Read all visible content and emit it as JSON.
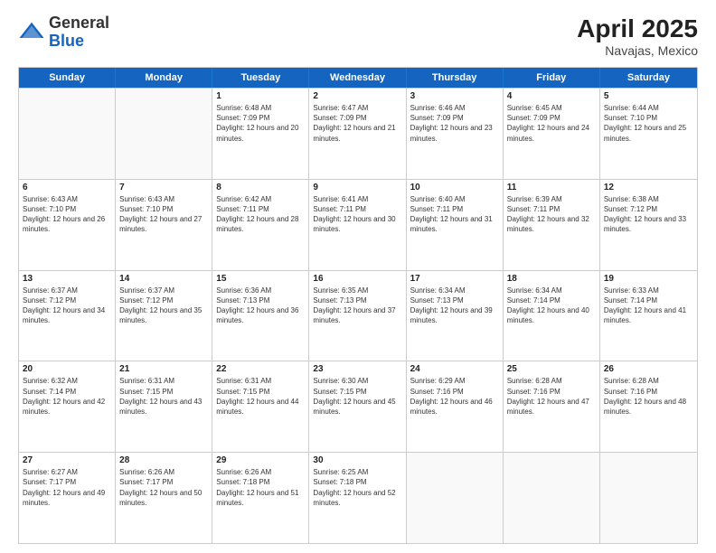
{
  "header": {
    "logo_general": "General",
    "logo_blue": "Blue",
    "title": "April 2025",
    "subtitle": "Navajas, Mexico"
  },
  "days_of_week": [
    "Sunday",
    "Monday",
    "Tuesday",
    "Wednesday",
    "Thursday",
    "Friday",
    "Saturday"
  ],
  "weeks": [
    [
      {
        "day": "",
        "info": ""
      },
      {
        "day": "",
        "info": ""
      },
      {
        "day": "1",
        "info": "Sunrise: 6:48 AM\nSunset: 7:09 PM\nDaylight: 12 hours and 20 minutes."
      },
      {
        "day": "2",
        "info": "Sunrise: 6:47 AM\nSunset: 7:09 PM\nDaylight: 12 hours and 21 minutes."
      },
      {
        "day": "3",
        "info": "Sunrise: 6:46 AM\nSunset: 7:09 PM\nDaylight: 12 hours and 23 minutes."
      },
      {
        "day": "4",
        "info": "Sunrise: 6:45 AM\nSunset: 7:09 PM\nDaylight: 12 hours and 24 minutes."
      },
      {
        "day": "5",
        "info": "Sunrise: 6:44 AM\nSunset: 7:10 PM\nDaylight: 12 hours and 25 minutes."
      }
    ],
    [
      {
        "day": "6",
        "info": "Sunrise: 6:43 AM\nSunset: 7:10 PM\nDaylight: 12 hours and 26 minutes."
      },
      {
        "day": "7",
        "info": "Sunrise: 6:43 AM\nSunset: 7:10 PM\nDaylight: 12 hours and 27 minutes."
      },
      {
        "day": "8",
        "info": "Sunrise: 6:42 AM\nSunset: 7:11 PM\nDaylight: 12 hours and 28 minutes."
      },
      {
        "day": "9",
        "info": "Sunrise: 6:41 AM\nSunset: 7:11 PM\nDaylight: 12 hours and 30 minutes."
      },
      {
        "day": "10",
        "info": "Sunrise: 6:40 AM\nSunset: 7:11 PM\nDaylight: 12 hours and 31 minutes."
      },
      {
        "day": "11",
        "info": "Sunrise: 6:39 AM\nSunset: 7:11 PM\nDaylight: 12 hours and 32 minutes."
      },
      {
        "day": "12",
        "info": "Sunrise: 6:38 AM\nSunset: 7:12 PM\nDaylight: 12 hours and 33 minutes."
      }
    ],
    [
      {
        "day": "13",
        "info": "Sunrise: 6:37 AM\nSunset: 7:12 PM\nDaylight: 12 hours and 34 minutes."
      },
      {
        "day": "14",
        "info": "Sunrise: 6:37 AM\nSunset: 7:12 PM\nDaylight: 12 hours and 35 minutes."
      },
      {
        "day": "15",
        "info": "Sunrise: 6:36 AM\nSunset: 7:13 PM\nDaylight: 12 hours and 36 minutes."
      },
      {
        "day": "16",
        "info": "Sunrise: 6:35 AM\nSunset: 7:13 PM\nDaylight: 12 hours and 37 minutes."
      },
      {
        "day": "17",
        "info": "Sunrise: 6:34 AM\nSunset: 7:13 PM\nDaylight: 12 hours and 39 minutes."
      },
      {
        "day": "18",
        "info": "Sunrise: 6:34 AM\nSunset: 7:14 PM\nDaylight: 12 hours and 40 minutes."
      },
      {
        "day": "19",
        "info": "Sunrise: 6:33 AM\nSunset: 7:14 PM\nDaylight: 12 hours and 41 minutes."
      }
    ],
    [
      {
        "day": "20",
        "info": "Sunrise: 6:32 AM\nSunset: 7:14 PM\nDaylight: 12 hours and 42 minutes."
      },
      {
        "day": "21",
        "info": "Sunrise: 6:31 AM\nSunset: 7:15 PM\nDaylight: 12 hours and 43 minutes."
      },
      {
        "day": "22",
        "info": "Sunrise: 6:31 AM\nSunset: 7:15 PM\nDaylight: 12 hours and 44 minutes."
      },
      {
        "day": "23",
        "info": "Sunrise: 6:30 AM\nSunset: 7:15 PM\nDaylight: 12 hours and 45 minutes."
      },
      {
        "day": "24",
        "info": "Sunrise: 6:29 AM\nSunset: 7:16 PM\nDaylight: 12 hours and 46 minutes."
      },
      {
        "day": "25",
        "info": "Sunrise: 6:28 AM\nSunset: 7:16 PM\nDaylight: 12 hours and 47 minutes."
      },
      {
        "day": "26",
        "info": "Sunrise: 6:28 AM\nSunset: 7:16 PM\nDaylight: 12 hours and 48 minutes."
      }
    ],
    [
      {
        "day": "27",
        "info": "Sunrise: 6:27 AM\nSunset: 7:17 PM\nDaylight: 12 hours and 49 minutes."
      },
      {
        "day": "28",
        "info": "Sunrise: 6:26 AM\nSunset: 7:17 PM\nDaylight: 12 hours and 50 minutes."
      },
      {
        "day": "29",
        "info": "Sunrise: 6:26 AM\nSunset: 7:18 PM\nDaylight: 12 hours and 51 minutes."
      },
      {
        "day": "30",
        "info": "Sunrise: 6:25 AM\nSunset: 7:18 PM\nDaylight: 12 hours and 52 minutes."
      },
      {
        "day": "",
        "info": ""
      },
      {
        "day": "",
        "info": ""
      },
      {
        "day": "",
        "info": ""
      }
    ]
  ]
}
